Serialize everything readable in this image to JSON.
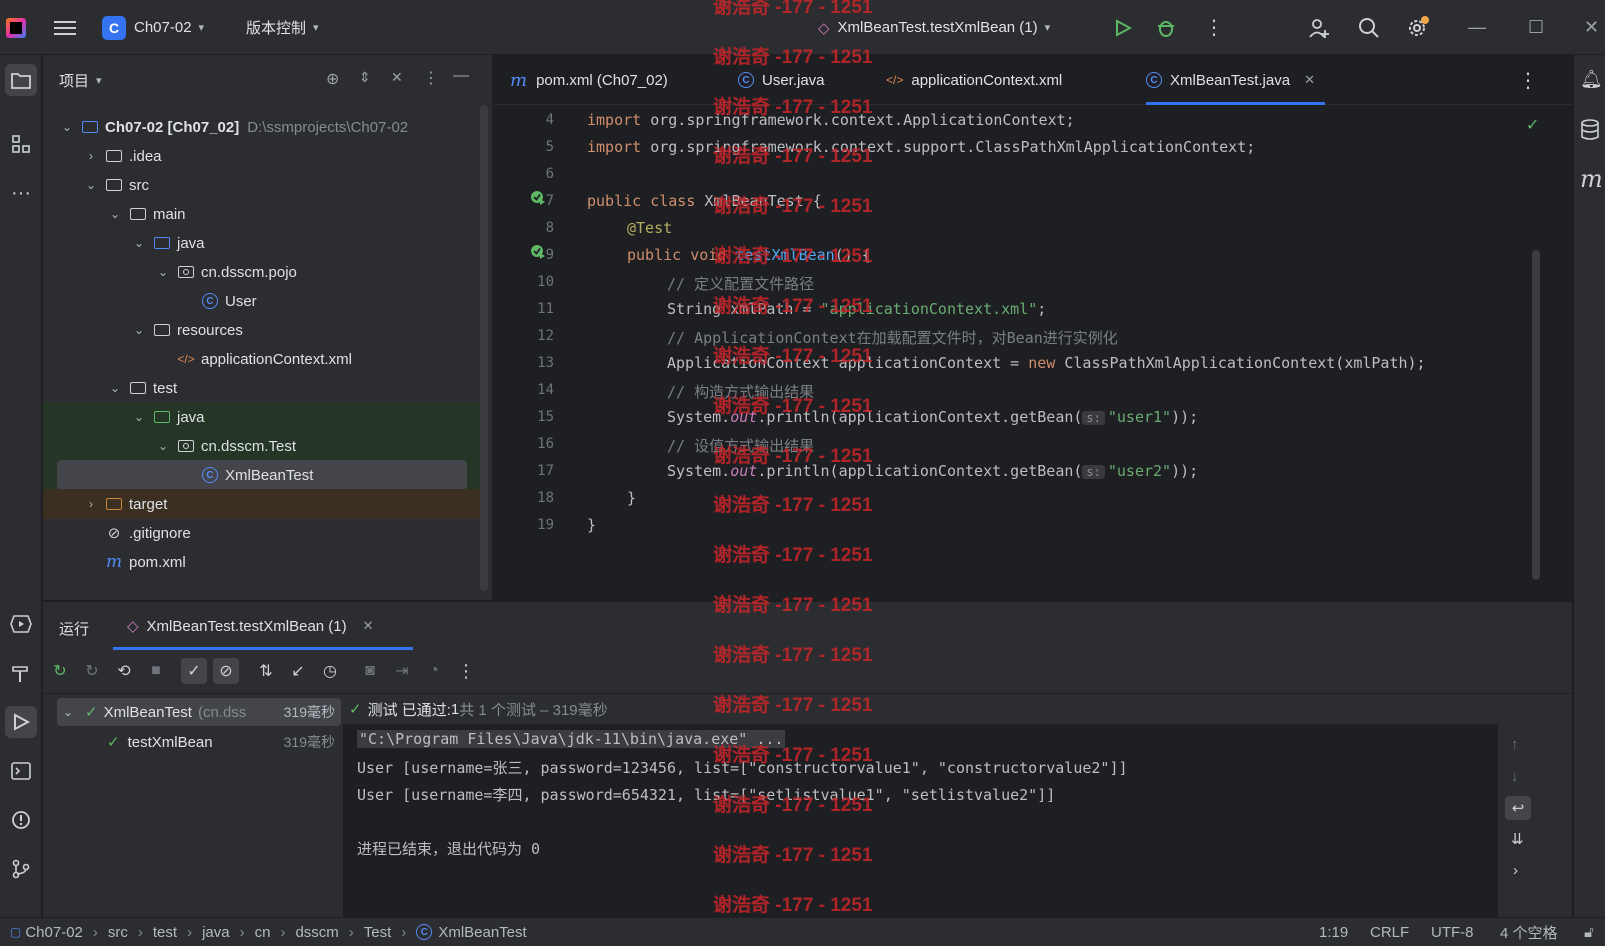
{
  "titlebar": {
    "project_badge": "C",
    "project_name": "Ch07-02",
    "vcs_label": "版本控制",
    "run_config": "XmlBeanTest.testXmlBean (1)"
  },
  "project_panel": {
    "title": "项目",
    "tree": [
      {
        "label": "Ch07-02 [Ch07_02]",
        "extra": "D:\\ssmprojects\\Ch07-02"
      },
      {
        "label": ".idea"
      },
      {
        "label": "src"
      },
      {
        "label": "main"
      },
      {
        "label": "java"
      },
      {
        "label": "cn.dsscm.pojo"
      },
      {
        "label": "User"
      },
      {
        "label": "resources"
      },
      {
        "label": "applicationContext.xml"
      },
      {
        "label": "test"
      },
      {
        "label": "java"
      },
      {
        "label": "cn.dsscm.Test"
      },
      {
        "label": "XmlBeanTest"
      },
      {
        "label": "target"
      },
      {
        "label": ".gitignore"
      },
      {
        "label": "pom.xml"
      }
    ]
  },
  "editor": {
    "tabs": [
      {
        "label": "pom.xml (Ch07_02)",
        "icon": "m"
      },
      {
        "label": "User.java",
        "icon": "C"
      },
      {
        "label": "applicationContext.xml",
        "icon": "xml"
      },
      {
        "label": "XmlBeanTest.java",
        "icon": "C"
      }
    ],
    "line_numbers": [
      "4",
      "5",
      "6",
      "7",
      "8",
      "9",
      "10",
      "11",
      "12",
      "13",
      "14",
      "15",
      "16",
      "17",
      "18",
      "19"
    ],
    "code": {
      "l4_kw": "import",
      "l4_rest": " org.springframework.context.ApplicationContext;",
      "l5_kw": "import",
      "l5_rest": " org.springframework.context.support.ClassPathXmlApplicationContext;",
      "l7_kw": "public class",
      "l7_rest": " XmlBeanTest {",
      "l8_ann": "@Test",
      "l9_kw": "public void",
      "l9_fn": "testXmlBean",
      "l9_rest": "() {",
      "l10_cmt": "// 定义配置文件路径",
      "l11_a": "String xmlPath = ",
      "l11_str": "\"applicationContext.xml\"",
      "l11_b": ";",
      "l12_cmt": "// ApplicationContext在加载配置文件时，对Bean进行实例化",
      "l13_a": "ApplicationContext applicationContext = ",
      "l13_kw": "new",
      "l13_b": " ClassPathXmlApplicationContext(xmlPath);",
      "l14_cmt": "// 构造方式输出结果",
      "l15_a": "System.",
      "l15_stat": "out",
      "l15_b": ".println(applicationContext.getBean(",
      "l15_hint": "s:",
      "l15_str": "\"user1\"",
      "l15_c": "));",
      "l16_cmt": "// 设值方式输出结果",
      "l17_a": "System.",
      "l17_stat": "out",
      "l17_b": ".println(applicationContext.getBean(",
      "l17_hint": "s:",
      "l17_str": "\"user2\"",
      "l17_c": "));",
      "l18": "}",
      "l19": "}"
    }
  },
  "run_panel": {
    "title": "运行",
    "run_tab": "XmlBeanTest.testXmlBean (1)",
    "tests": [
      {
        "name": "XmlBeanTest",
        "pkg": "(cn.dss",
        "time": "319毫秒"
      },
      {
        "name": "testXmlBean",
        "time": "319毫秒"
      }
    ],
    "summary_label": "测试 已通过: ",
    "summary_count": "1",
    "summary_rest": "共 1 个测试 – 319毫秒",
    "console": [
      "\"C:\\Program Files\\Java\\jdk-11\\bin\\java.exe\" ...",
      "User [username=张三, password=123456, list=[\"constructorvalue1\", \"constructorvalue2\"]]",
      "User [username=李四, password=654321, list=[\"setlistvalue1\", \"setlistvalue2\"]]",
      "",
      "进程已结束，退出代码为 0"
    ]
  },
  "statusbar": {
    "breadcrumbs": [
      "Ch07-02",
      "src",
      "test",
      "java",
      "cn",
      "dsscm",
      "Test",
      "XmlBeanTest"
    ],
    "position": "1:19",
    "line_sep": "CRLF",
    "encoding": "UTF-8",
    "indent": "4 个空格"
  },
  "watermark": "谢浩奇 -177 - 1251"
}
